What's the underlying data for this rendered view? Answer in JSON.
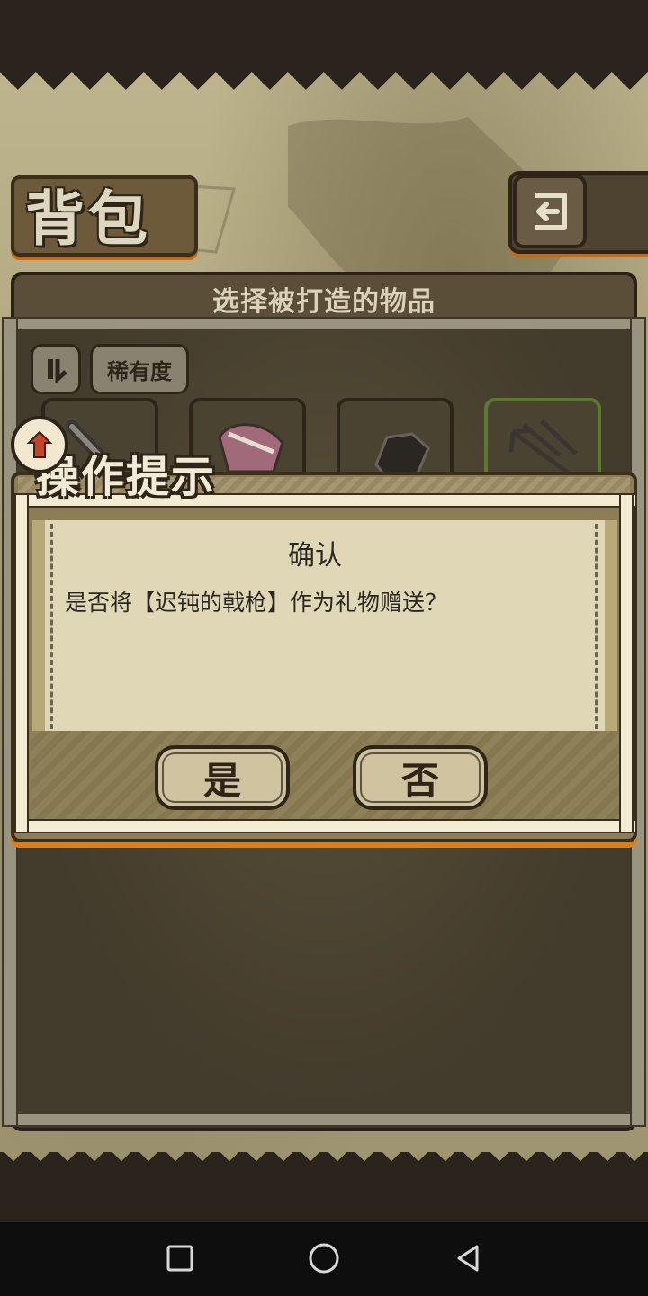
{
  "screen": {
    "title": "背包",
    "panel_header": "选择被打造的物品",
    "rarity_filter": "稀有度"
  },
  "inventory": {
    "items": [
      {
        "icon": "sword-icon"
      },
      {
        "icon": "armor-icon"
      },
      {
        "icon": "gauntlet-icon"
      },
      {
        "icon": "trident-icon",
        "highlight": "green"
      }
    ]
  },
  "dialog": {
    "title": "操作提示",
    "heading": "确认",
    "message": "是否将【迟钝的戟枪】作为礼物赠送？",
    "yes_label": "是",
    "no_label": "否"
  },
  "colors": {
    "accent": "#d9801e",
    "paper": "#e0d7b7",
    "frame": "#3a2e1c"
  }
}
